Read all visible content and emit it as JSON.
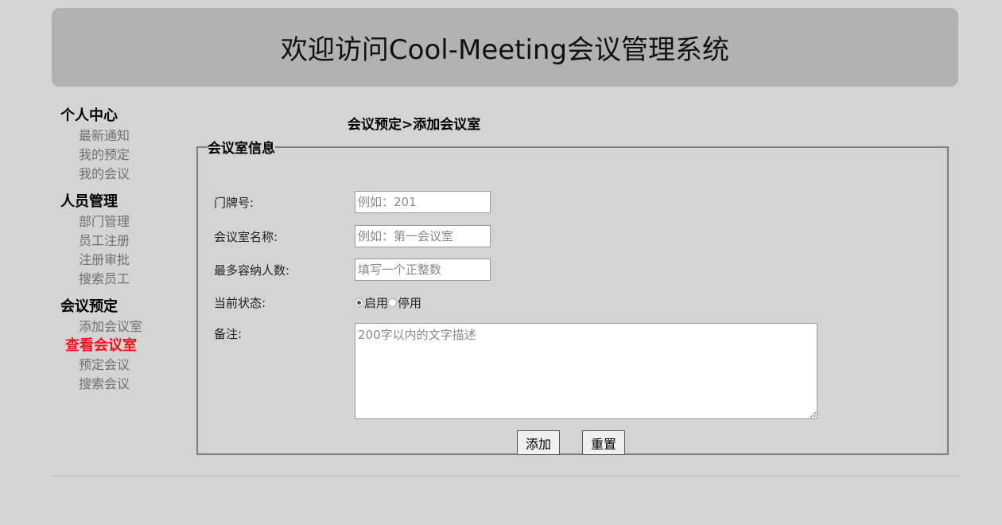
{
  "header": {
    "title": "欢迎访问Cool-Meeting会议管理系统"
  },
  "sidebar": {
    "groups": [
      {
        "title": "个人中心",
        "items": [
          "最新通知",
          "我的预定",
          "我的会议"
        ]
      },
      {
        "title": "人员管理",
        "items": [
          "部门管理",
          "员工注册",
          "注册审批",
          "搜索员工"
        ]
      },
      {
        "title": "会议预定",
        "items": [
          "添加会议室",
          "查看会议室",
          "预定会议",
          "搜索会议"
        ]
      }
    ],
    "active_item": "查看会议室"
  },
  "breadcrumb": "会议预定>添加会议室",
  "form": {
    "legend": "会议室信息",
    "room_number": {
      "label": "门牌号:",
      "placeholder": "例如：201",
      "value": ""
    },
    "room_name": {
      "label": "会议室名称:",
      "placeholder": "例如：第一会议室",
      "value": ""
    },
    "capacity": {
      "label": "最多容纳人数:",
      "placeholder": "填写一个正整数",
      "value": ""
    },
    "status": {
      "label": "当前状态:",
      "options": [
        "启用",
        "停用"
      ],
      "selected": "启用"
    },
    "note": {
      "label": "备注:",
      "placeholder": "200字以内的文字描述",
      "value": ""
    },
    "add_label": "添加",
    "reset_label": "重置"
  },
  "colors": {
    "background": "#d4d4d4",
    "header": "#b2b2b2",
    "active_menu": "#f0141e"
  }
}
